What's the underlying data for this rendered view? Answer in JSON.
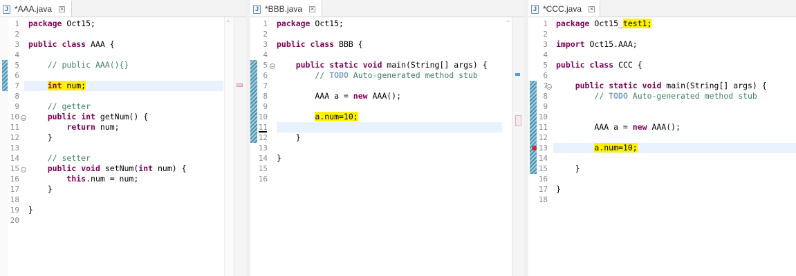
{
  "editors": [
    {
      "tab_title": "*AAA.java",
      "file_icon": "java-file-icon",
      "lines": [
        {
          "n": "1",
          "t": "package Oct15;"
        },
        {
          "n": "2",
          "t": ""
        },
        {
          "n": "3",
          "t": "public class AAA {"
        },
        {
          "n": "4",
          "t": ""
        },
        {
          "n": "5",
          "t": "    // public AAA(){}"
        },
        {
          "n": "6",
          "t": ""
        },
        {
          "n": "7",
          "t": "    int num;"
        },
        {
          "n": "8",
          "t": ""
        },
        {
          "n": "9",
          "t": "    // getter"
        },
        {
          "n": "10",
          "t": "    public int getNum() {"
        },
        {
          "n": "11",
          "t": "        return num;"
        },
        {
          "n": "12",
          "t": "    }"
        },
        {
          "n": "13",
          "t": ""
        },
        {
          "n": "14",
          "t": "    // setter"
        },
        {
          "n": "15",
          "t": "    public void setNum(int num) {"
        },
        {
          "n": "16",
          "t": "        this.num = num;"
        },
        {
          "n": "17",
          "t": "    }"
        },
        {
          "n": "18",
          "t": ""
        },
        {
          "n": "19",
          "t": "}"
        },
        {
          "n": "20",
          "t": ""
        }
      ]
    },
    {
      "tab_title": "*BBB.java",
      "file_icon": "java-file-icon",
      "lines": [
        {
          "n": "1",
          "t": "package Oct15;"
        },
        {
          "n": "2",
          "t": ""
        },
        {
          "n": "3",
          "t": "public class BBB {"
        },
        {
          "n": "4",
          "t": ""
        },
        {
          "n": "5",
          "t": "    public static void main(String[] args) {"
        },
        {
          "n": "6",
          "t": "        // TODO Auto-generated method stub"
        },
        {
          "n": "7",
          "t": ""
        },
        {
          "n": "8",
          "t": "        AAA a = new AAA();"
        },
        {
          "n": "9",
          "t": ""
        },
        {
          "n": "10",
          "t": "        a.num=10;"
        },
        {
          "n": "11",
          "t": ""
        },
        {
          "n": "12",
          "t": "    }"
        },
        {
          "n": "13",
          "t": ""
        },
        {
          "n": "14",
          "t": "}"
        },
        {
          "n": "15",
          "t": ""
        },
        {
          "n": "16",
          "t": ""
        }
      ]
    },
    {
      "tab_title": "*CCC.java",
      "file_icon": "java-file-icon",
      "lines": [
        {
          "n": "1",
          "t": "package Oct15_test1;"
        },
        {
          "n": "2",
          "t": ""
        },
        {
          "n": "3",
          "t": "import Oct15.AAA;"
        },
        {
          "n": "4",
          "t": ""
        },
        {
          "n": "5",
          "t": "public class CCC {"
        },
        {
          "n": "6",
          "t": ""
        },
        {
          "n": "7",
          "t": "    public static void main(String[] args) {"
        },
        {
          "n": "8",
          "t": "        // TODO Auto-generated method stub"
        },
        {
          "n": "9",
          "t": ""
        },
        {
          "n": "10",
          "t": ""
        },
        {
          "n": "11",
          "t": "        AAA a = new AAA();"
        },
        {
          "n": "12",
          "t": ""
        },
        {
          "n": "13",
          "t": "        a.num=10;"
        },
        {
          "n": "14",
          "t": ""
        },
        {
          "n": "15",
          "t": "    }"
        },
        {
          "n": "16",
          "t": ""
        },
        {
          "n": "17",
          "t": "}"
        },
        {
          "n": "18",
          "t": ""
        }
      ]
    }
  ],
  "colors": {
    "keyword": "#7f0055",
    "comment": "#3f7f5f",
    "field": "#0000c0",
    "highlight": "#fff200",
    "current_line": "#e8f2fe"
  }
}
